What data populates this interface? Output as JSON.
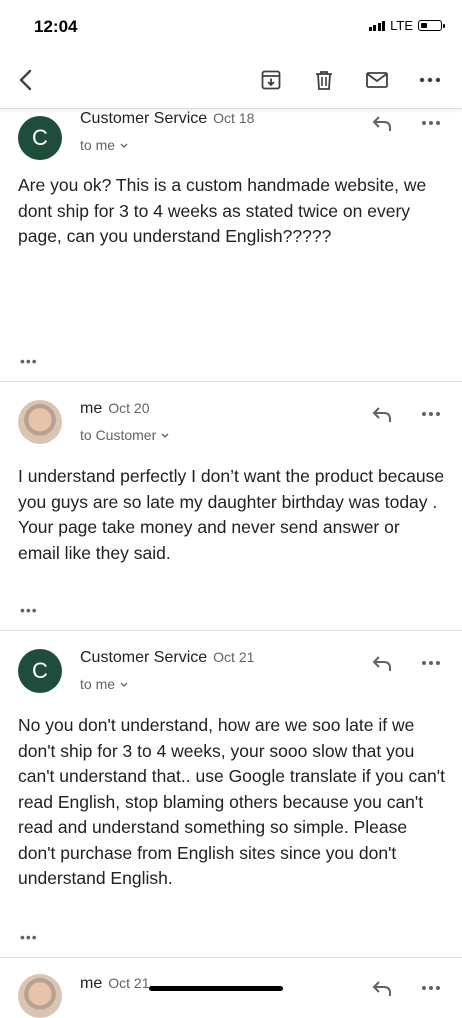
{
  "status": {
    "time": "12:04",
    "network": "LTE"
  },
  "toolbar": {
    "back_icon": "back-arrow-icon",
    "archive_icon": "archive-icon",
    "delete_icon": "trash-icon",
    "mark_unread_icon": "mail-icon",
    "more_icon": "more-horizontal-icon"
  },
  "messages": [
    {
      "avatar_letter": "C",
      "sender": "Customer Service",
      "date": "Oct 18",
      "recipient": "to me",
      "body": "Are you ok? This is a custom handmade website, we dont ship for 3 to 4 weeks as stated twice on every  page, can you understand English?????",
      "more": "•••"
    },
    {
      "sender": "me",
      "date": "Oct 20",
      "recipient": "to Customer",
      "body": "I understand perfectly I don’t want the product because you guys are so late my daughter birthday was today . Your page take money and never send answer or email like they said.",
      "more": "•••"
    },
    {
      "avatar_letter": "C",
      "sender": "Customer Service",
      "date": "Oct 21",
      "recipient": "to me",
      "body": "No you don't understand,  how are we soo late if we don't ship for 3 to 4 weeks, your sooo slow that you can't understand that.. use Google translate if you can't read English, stop blaming others because you can't read and understand something so simple. Please don't purchase from English sites since you don't understand English.",
      "more": "•••"
    },
    {
      "sender": "me",
      "date": "Oct 21"
    }
  ]
}
